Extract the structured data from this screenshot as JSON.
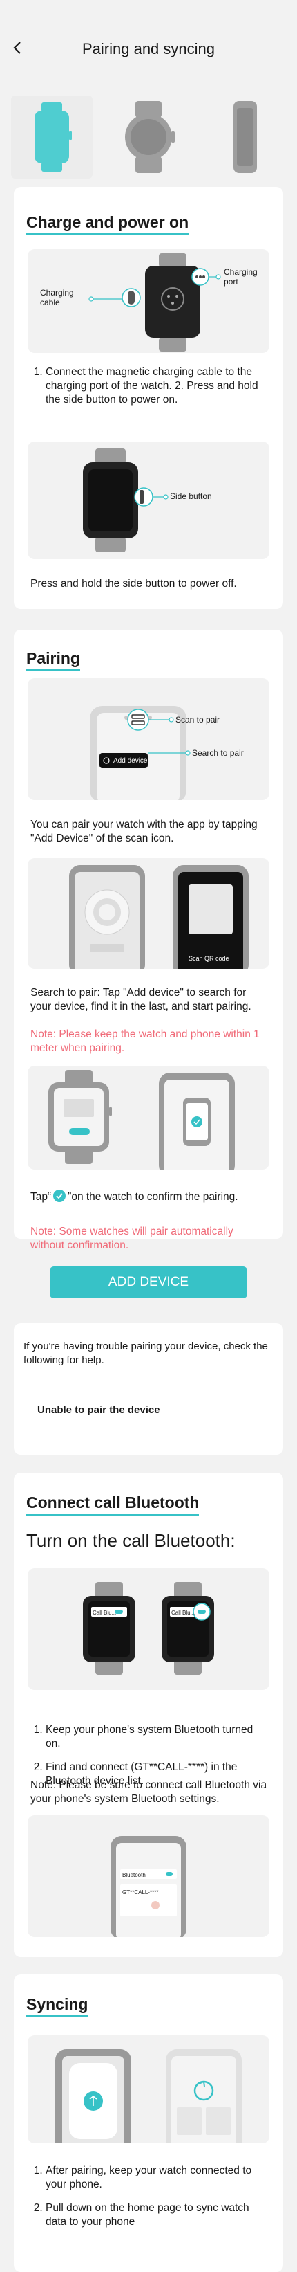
{
  "header": {
    "title": "Pairing and syncing"
  },
  "watch_tabs": [
    {
      "name": "square-watch-teal",
      "selected": true
    },
    {
      "name": "round-watch-grey",
      "selected": false
    },
    {
      "name": "band-watch-grey",
      "selected": false
    }
  ],
  "charge": {
    "title": "Charge and power on",
    "label_cable": "Charging\ncable",
    "label_port": "Charging\nport",
    "step1": "Connect the magnetic charging cable to the charging port of the watch. 2. Press and hold the side button to power on.",
    "label_side_button": "Side button",
    "power_off": "Press and hold the side button to power off."
  },
  "pairing": {
    "title": "Pairing",
    "label_scan": "Scan to pair",
    "label_search": "Search to pair",
    "phone_add_device": "Add device",
    "scan_intro": "You can pair your watch with the app by tapping \"Add Device\" of the scan icon.",
    "phone_scan_qr": "Scan QR code",
    "search_desc": "Search to pair: Tap \"Add device\" to search for your device, find it in the last, and start pairing.",
    "note_distance": "Note: Please keep the watch and phone within 1 meter when pairing.",
    "tap_before": "Tap“",
    "tap_after": "”on the watch to confirm the pairing.",
    "note_auto": "Note: Some watches will pair automatically without confirmation.",
    "add_device_button": "ADD DEVICE"
  },
  "help": {
    "text": "If you're having trouble pairing your device, check the following for help.",
    "link": "Unable to pair the device"
  },
  "call": {
    "title": "Connect call Bluetooth",
    "subtitle": "Turn on the call Bluetooth:",
    "watch_label": "Call Blu...",
    "steps": [
      "Keep your phone's system Bluetooth turned on.",
      "Find and connect (GT**CALL-****) in the Bluetooth device list."
    ],
    "note": "Note: Please be sure to connect call Bluetooth via your phone's system Bluetooth settings.",
    "phone_bluetooth": "Bluetooth",
    "phone_device": "GT**CALL-****"
  },
  "syncing": {
    "title": "Syncing",
    "steps": [
      "After pairing, keep your watch connected to your phone.",
      "Pull down on the home page to sync watch data to your phone"
    ]
  },
  "colors": {
    "accent": "#37c2c7",
    "note": "#f06a78"
  }
}
